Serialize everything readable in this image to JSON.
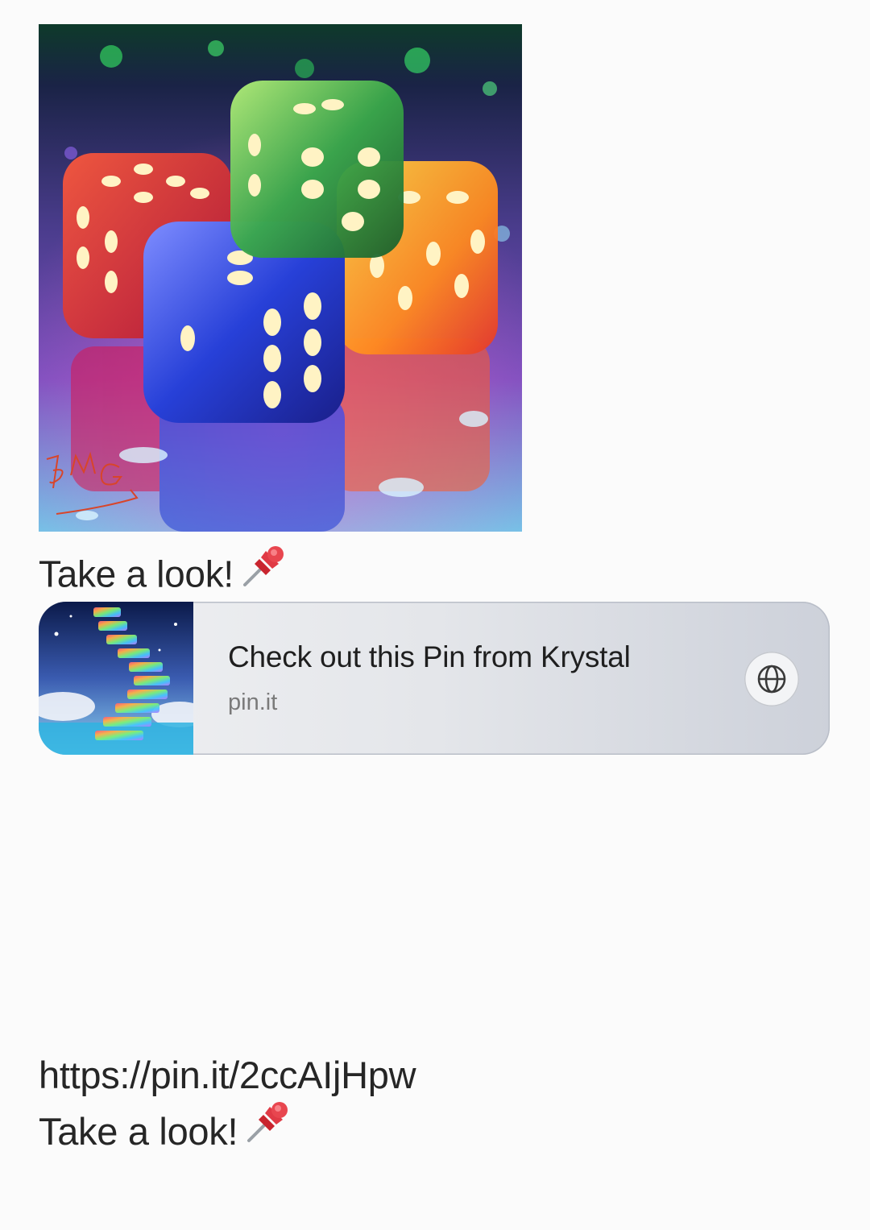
{
  "message": {
    "image": {
      "description_icon": "dice-image",
      "signature": "BMG"
    },
    "caption": "Take a look!",
    "caption_emoji": "pushpin-icon",
    "link_preview": {
      "title": "Check out this Pin from Krystal",
      "domain": "pin.it",
      "action_icon": "globe-icon"
    },
    "body": {
      "url": "https://pin.it/2ccAIjHpw",
      "text": "Take a look!"
    }
  },
  "colors": {
    "background": "#fbfbfb",
    "text": "#262626",
    "card_title": "#1f1f1f",
    "card_domain": "#7a7a7a"
  }
}
